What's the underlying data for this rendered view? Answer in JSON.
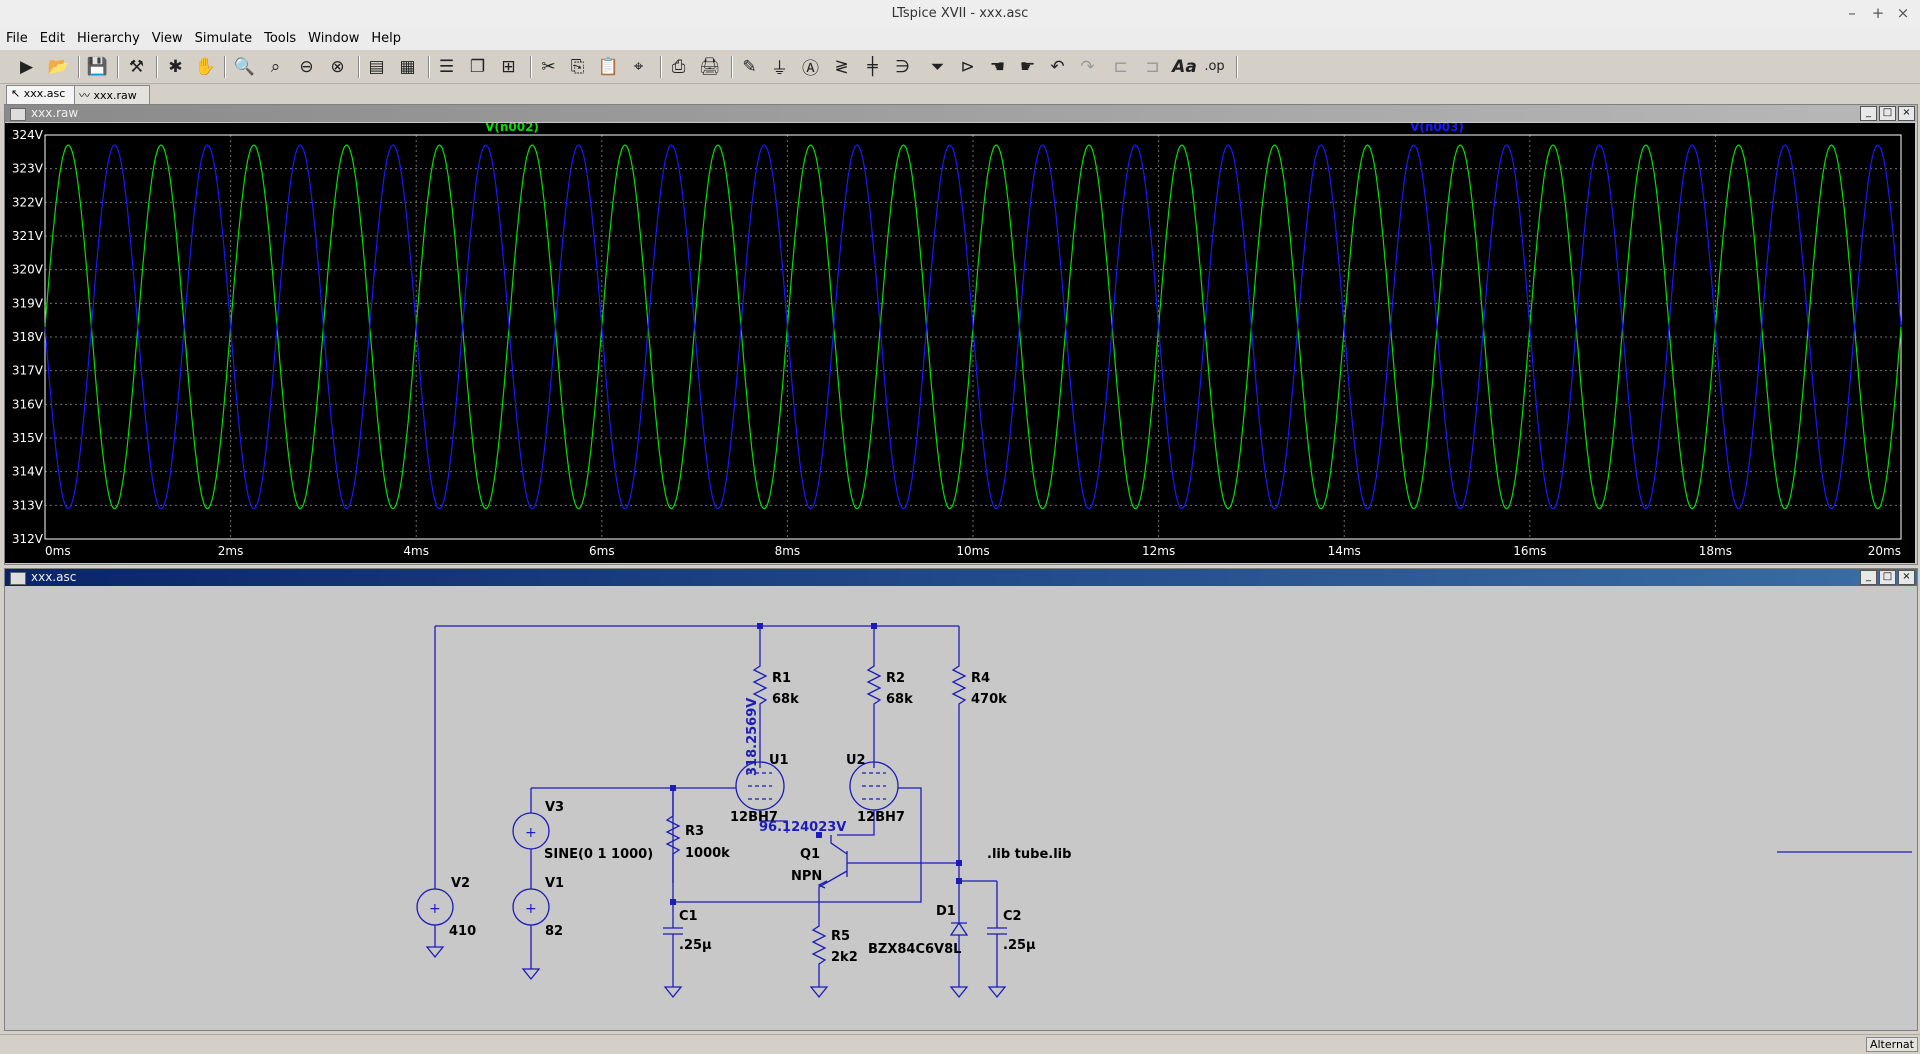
{
  "window": {
    "title": "LTspice XVII - xxx.asc",
    "minimize": "–",
    "maximize": "+",
    "close": "×"
  },
  "menu": [
    "File",
    "Edit",
    "Hierarchy",
    "View",
    "Simulate",
    "Tools",
    "Window",
    "Help"
  ],
  "toolbar_icons": [
    "run-icon",
    "open-icon",
    "save-icon",
    "control-panel-icon",
    "halt-icon",
    "pan-icon",
    "zoom-in-icon",
    "zoom-area-icon",
    "zoom-out-icon",
    "zoom-fit-icon",
    "autorange-icon",
    "grid-icon",
    "tile-horizontal-icon",
    "cascade-icon",
    "tile-vertical-icon",
    "cut-icon",
    "copy-icon",
    "paste-icon",
    "find-icon",
    "print-setup-icon",
    "print-icon",
    "draw-wire-icon",
    "ground-icon",
    "label-net-icon",
    "resistor-icon",
    "capacitor-icon",
    "inductor-icon",
    "diode-icon",
    "component-icon",
    "move-icon",
    "drag-icon",
    "undo-icon",
    "redo-icon",
    "rotate-icon",
    "mirror-icon",
    "text-icon",
    "spice-directive-icon"
  ],
  "toolbar_text": {
    "text_tool": "Aa",
    "spice_tool": ".op"
  },
  "tabs": [
    {
      "label": "xxx.asc",
      "active": true
    },
    {
      "label": "xxx.raw",
      "active": false
    }
  ],
  "waveform_window": {
    "title": "xxx.raw",
    "btn_min": "_",
    "btn_max": "□",
    "btn_close": "×"
  },
  "schematic_window": {
    "title": "xxx.asc",
    "btn_min": "_",
    "btn_max": "□",
    "btn_close": "×"
  },
  "chart_data": {
    "type": "line",
    "background": "#000000",
    "grid": true,
    "xlim": [
      0,
      20
    ],
    "ylim": [
      312,
      324
    ],
    "xticks": [
      "0ms",
      "2ms",
      "4ms",
      "6ms",
      "8ms",
      "10ms",
      "12ms",
      "14ms",
      "16ms",
      "18ms",
      "20ms"
    ],
    "yticks": [
      "312V",
      "313V",
      "314V",
      "315V",
      "316V",
      "317V",
      "318V",
      "319V",
      "320V",
      "321V",
      "322V",
      "323V",
      "324V"
    ],
    "series": [
      {
        "name": "V(n002)",
        "color": "#00e000",
        "function": "sine",
        "offset": 318.3,
        "amplitude": 5.4,
        "frequency_khz": 1,
        "phase": 1
      },
      {
        "name": "V(n003)",
        "color": "#1818ff",
        "function": "sine",
        "offset": 318.3,
        "amplitude": 5.4,
        "frequency_khz": 1,
        "phase": -1
      }
    ]
  },
  "schematic": {
    "wire_color": "#1c1cb8",
    "components": {
      "R1": {
        "name": "R1",
        "value": "68k"
      },
      "R2": {
        "name": "R2",
        "value": "68k"
      },
      "R3": {
        "name": "R3",
        "value": "1000k"
      },
      "R4": {
        "name": "R4",
        "value": "470k"
      },
      "R5": {
        "name": "R5",
        "value": "2k2"
      },
      "C1": {
        "name": "C1",
        "value": ".25µ"
      },
      "C2": {
        "name": "C2",
        "value": ".25µ"
      },
      "U1": {
        "name": "U1",
        "value": "12BH7"
      },
      "U2": {
        "name": "U2",
        "value": "12BH7"
      },
      "Q1": {
        "name": "Q1",
        "value": "NPN"
      },
      "D1": {
        "name": "D1",
        "value": "BZX84C6V8L"
      },
      "V1": {
        "name": "V1",
        "value": "82"
      },
      "V2": {
        "name": "V2",
        "value": "410"
      },
      "V3": {
        "name": "V3",
        "value": "SINE(0 1 1000)"
      }
    },
    "directive": ".lib tube.lib",
    "probe_labels": {
      "plate_voltage": "318.2569V",
      "emitter_voltage": "96.124023V"
    }
  },
  "status": {
    "right_text": "Alternat"
  }
}
